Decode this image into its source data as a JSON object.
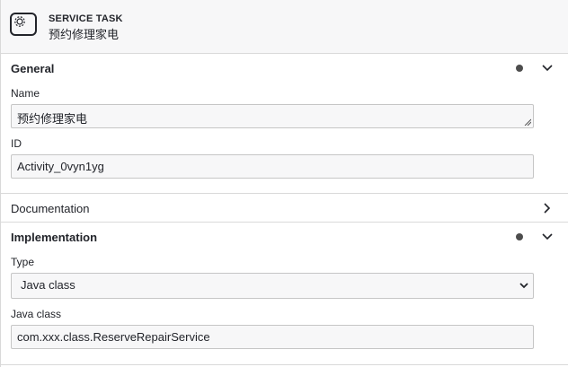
{
  "header": {
    "type": "SERVICE TASK",
    "name": "预约修理家电",
    "icon": "gear-icon"
  },
  "general": {
    "title": "General",
    "name_label": "Name",
    "name_value": "预约修理家电",
    "id_label": "ID",
    "id_value": "Activity_0vyn1yg"
  },
  "documentation": {
    "title": "Documentation"
  },
  "implementation": {
    "title": "Implementation",
    "type_label": "Type",
    "type_value": "Java class",
    "java_class_label": "Java class",
    "java_class_value": "com.xxx.class.ReserveRepairService"
  }
}
